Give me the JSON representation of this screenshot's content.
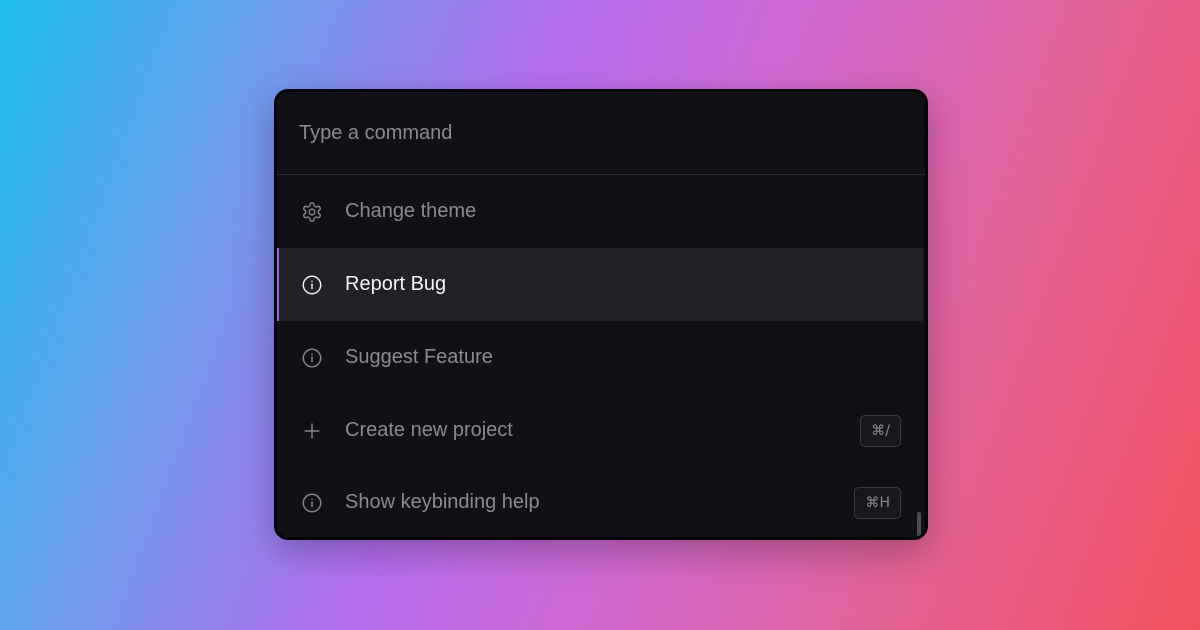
{
  "search": {
    "placeholder": "Type a command",
    "value": ""
  },
  "items": [
    {
      "label": "Change theme",
      "icon": "gear-icon",
      "shortcut": ""
    },
    {
      "label": "Report Bug",
      "icon": "info-icon",
      "shortcut": "",
      "active": true
    },
    {
      "label": "Suggest Feature",
      "icon": "info-icon",
      "shortcut": ""
    },
    {
      "label": "Create new project",
      "icon": "plus-icon",
      "shortcut": "⌘/"
    },
    {
      "label": "Show keybinding help",
      "icon": "info-icon",
      "shortcut": "⌘H"
    }
  ],
  "colors": {
    "accent": "#a35ed9",
    "panel": "#111115",
    "active_row": "#212126"
  }
}
